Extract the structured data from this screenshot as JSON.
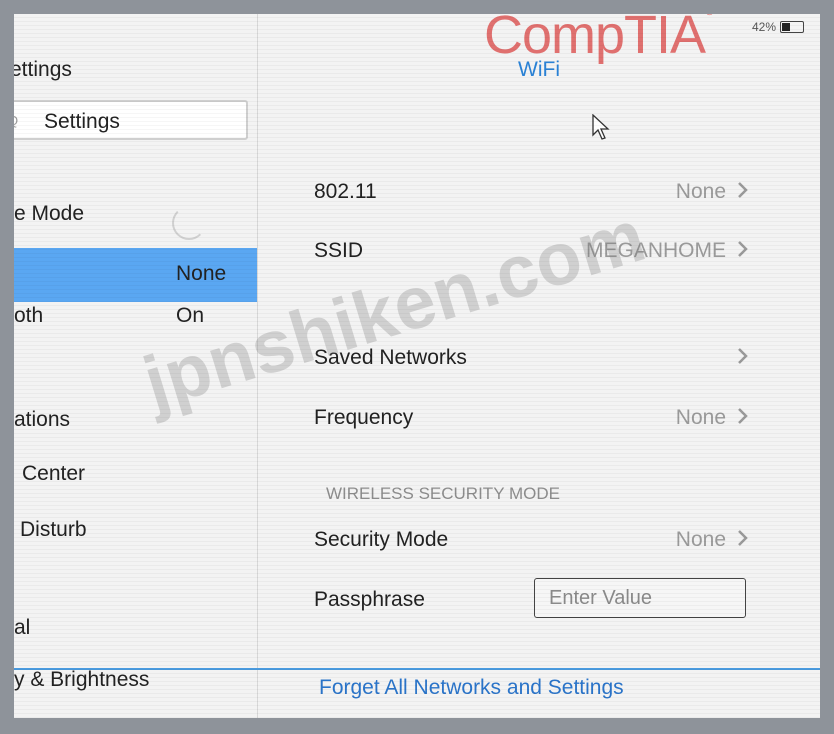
{
  "status_bar": {
    "battery": "42%"
  },
  "brand": {
    "name": "CompTIA",
    "color": "#e0706f"
  },
  "sidebar": {
    "title": "ettings",
    "search": {
      "label": "Settings"
    },
    "items": [
      {
        "label": "e Mode",
        "value": ""
      },
      {
        "label": "",
        "value": "None",
        "selected": true
      },
      {
        "label": "oth",
        "value": "On"
      },
      {
        "label": "ations",
        "value": ""
      },
      {
        "label": "Center",
        "value": ""
      },
      {
        "label": "Disturb",
        "value": ""
      },
      {
        "label": "al",
        "value": ""
      },
      {
        "label": "y & Brightness",
        "value": ""
      }
    ]
  },
  "detail": {
    "title": "WiFi",
    "rows": [
      {
        "label": "802.11",
        "value": "None"
      },
      {
        "label": "SSID",
        "value": "MEGANHOME"
      },
      {
        "label": "Saved Networks",
        "value": ""
      },
      {
        "label": "Frequency",
        "value": "None"
      }
    ],
    "section_header": "WIRELESS SECURITY MODE",
    "security": {
      "label": "Security Mode",
      "value": "None"
    },
    "passphrase": {
      "label": "Passphrase",
      "placeholder": "Enter Value"
    },
    "forget_link": "Forget All Networks and Settings"
  },
  "watermark": "jpnshiken.com",
  "colors": {
    "accent": "#2a82d6",
    "selection": "#5aa7f2",
    "link": "#2a74c9"
  }
}
